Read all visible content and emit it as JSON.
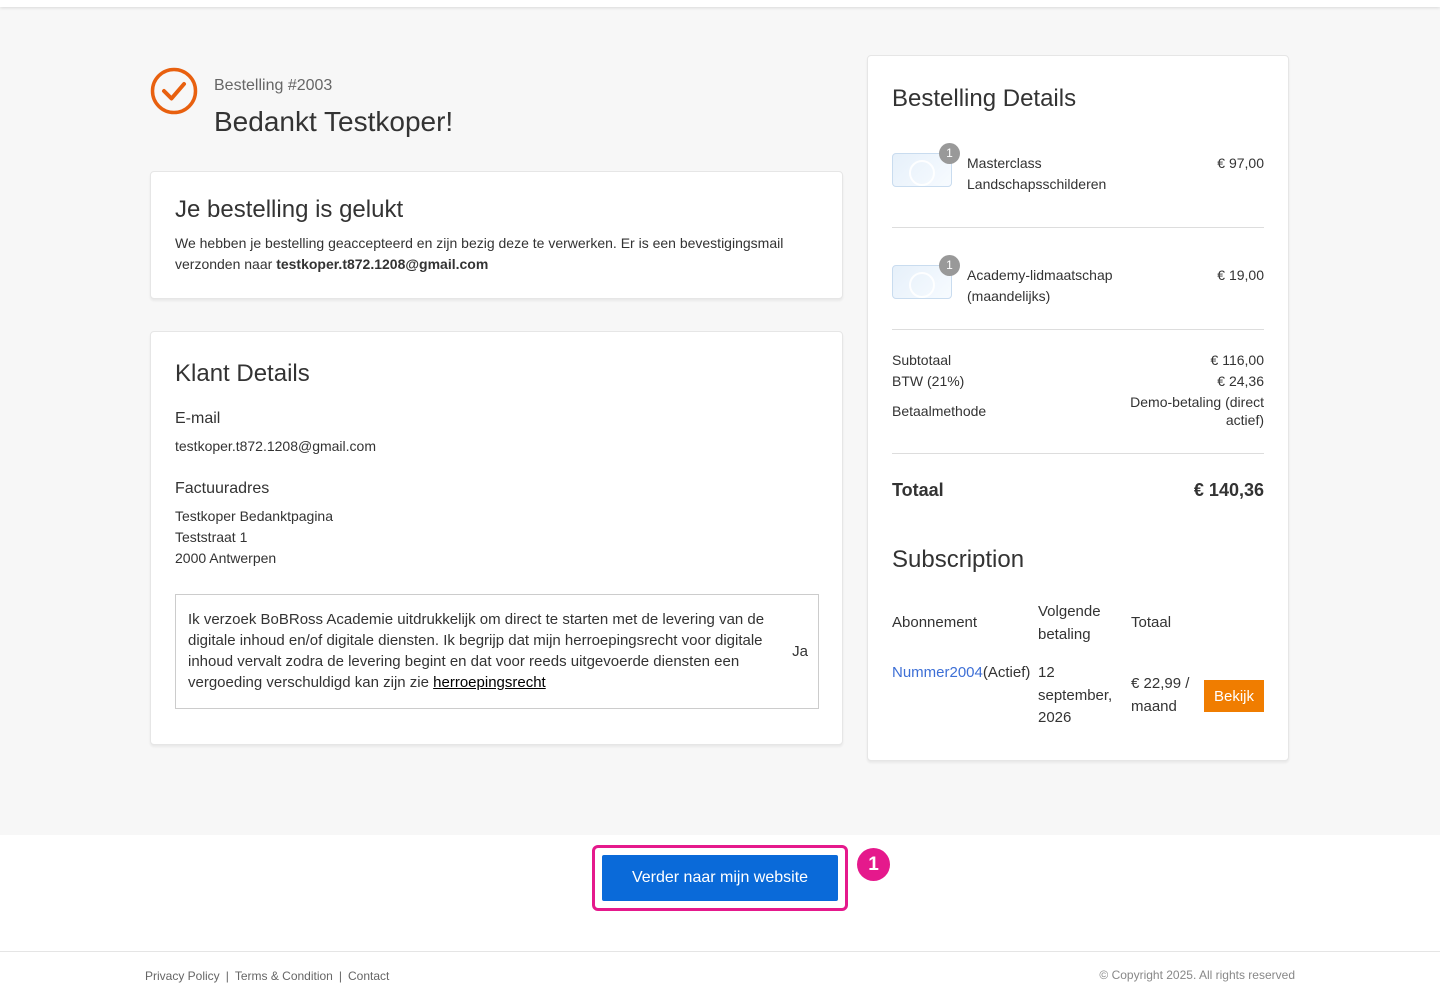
{
  "header": {
    "order_number": "Bestelling #2003",
    "thanks": "Bedankt Testkoper!"
  },
  "success_card": {
    "title": "Je bestelling is gelukt",
    "message": "We hebben je bestelling geaccepteerd en zijn bezig deze te verwerken. Er is een bevestigingsmail verzonden naar",
    "email": "testkoper.t872.1208@gmail.com"
  },
  "customer_card": {
    "title": "Klant Details",
    "email_label": "E-mail",
    "email": "testkoper.t872.1208@gmail.com",
    "billing_label": "Factuuradres",
    "billing_lines": [
      "Testkoper Bedanktpagina",
      "Teststraat 1",
      "2000 Antwerpen"
    ],
    "consent_text": "Ik verzoek BoBRoss Academie uitdrukkelijk om direct te starten met de levering van de digitale inhoud en/of digitale diensten. Ik begrijp dat mijn herroepingsrecht voor digitale inhoud vervalt zodra de levering begint en dat voor reeds uitgevoerde diensten een vergoeding verschuldigd kan zijn zie",
    "consent_link": "herroepingsrecht",
    "consent_answer": "Ja"
  },
  "order_card": {
    "title": "Bestelling Details",
    "items": [
      {
        "qty": "1",
        "name": "Masterclass Landschapsschilderen",
        "price": "€ 97,00"
      },
      {
        "qty": "1",
        "name": "Academy-lidmaatschap (maandelijks)",
        "price": "€ 19,00"
      }
    ],
    "subtotal_label": "Subtotaal",
    "subtotal": "€ 116,00",
    "vat_label": "BTW (21%)",
    "vat": "€ 24,36",
    "payment_label": "Betaalmethode",
    "payment": "Demo-betaling (direct actief)",
    "total_label": "Totaal",
    "total": "€ 140,36"
  },
  "subscription": {
    "title": "Subscription",
    "headers": {
      "plan": "Abonnement",
      "next": "Volgende betaling",
      "total": "Totaal"
    },
    "row": {
      "number": "Nummer2004",
      "status": "(Actief)",
      "next_date": "12 september, 2026",
      "amount": "€ 22,99 / maand",
      "button": "Bekijk"
    }
  },
  "cta": {
    "label": "Verder naar mijn website",
    "badge": "1"
  },
  "footer": {
    "links": [
      "Privacy Policy",
      "Terms & Condition",
      "Contact"
    ],
    "separator": "|",
    "copyright": "© Copyright 2025. All rights reserved"
  },
  "colors": {
    "accent": "#e8600f",
    "button_blue": "#0a6ad9",
    "button_orange": "#f07d00",
    "highlight": "#e5198c",
    "link": "#3d6fd6"
  }
}
